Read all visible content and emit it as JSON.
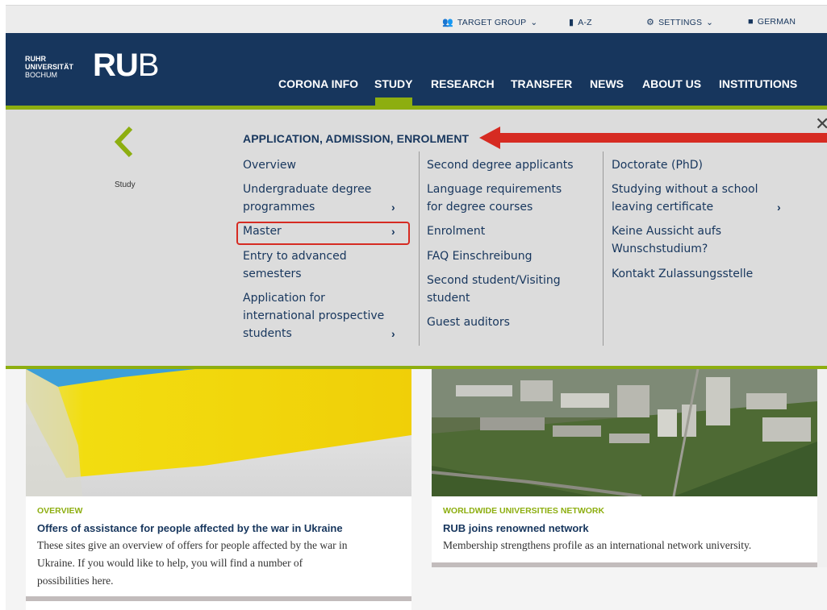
{
  "utility": {
    "target_group": "TARGET GROUP",
    "az": "A-Z",
    "settings": "SETTINGS",
    "language": "GERMAN"
  },
  "logo": {
    "line1": "RUHR",
    "line2": "UNIVERSITÄT",
    "line3": "BOCHUM",
    "mark_bold": "RU",
    "mark_light": "B"
  },
  "nav": {
    "items": [
      "CORONA INFO",
      "STUDY",
      "RESEARCH",
      "TRANSFER",
      "NEWS",
      "ABOUT US",
      "INSTITUTIONS"
    ],
    "active": "STUDY"
  },
  "mega": {
    "back_label": "Study",
    "title": "APPLICATION, ADMISSION, ENROLMENT",
    "col1": {
      "overview": "Overview",
      "undergrad_1": "Undergraduate degree",
      "undergrad_2": "programmes",
      "master": "Master",
      "advanced_1": "Entry to advanced",
      "advanced_2": "semesters",
      "intl_1": "Application for",
      "intl_2": "international prospective",
      "intl_3": "students"
    },
    "col2": {
      "second_degree": "Second degree applicants",
      "lang_1": "Language requirements",
      "lang_2": "for degree courses",
      "enrolment": "Enrolment",
      "faq": "FAQ Einschreibung",
      "visiting_1": "Second student/Visiting",
      "visiting_2": "student",
      "guest": "Guest auditors"
    },
    "col3": {
      "phd": "Doctorate (PhD)",
      "noschool_1": "Studying without a school",
      "noschool_2": "leaving certificate",
      "keine_1": "Keine Aussicht aufs",
      "keine_2": "Wunschstudium?",
      "kontakt": "Kontakt Zulassungsstelle"
    }
  },
  "cards": {
    "left": {
      "kicker": "OVERVIEW",
      "title": "Offers of assistance for people affected by the war in Ukraine",
      "text_1": "These sites give an overview of offers for people affected by the war in",
      "text_2": "Ukraine. If you would like to help, you will find a number of",
      "text_3": "possibilities here."
    },
    "right": {
      "kicker": "WORLDWIDE UNIVERSITIES NETWORK",
      "title": "RUB joins renowned network",
      "text_1": "Membership strengthens profile as an international network university."
    }
  },
  "colors": {
    "navy": "#17365d",
    "green": "#8dae10",
    "highlight_red": "#d62b22"
  }
}
